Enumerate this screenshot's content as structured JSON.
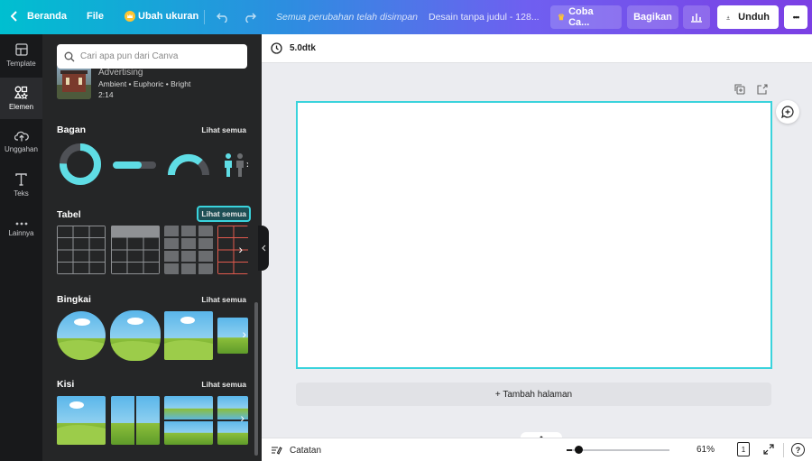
{
  "topbar": {
    "home_label": "Beranda",
    "file_label": "File",
    "resize_label": "Ubah ukuran",
    "save_status": "Semua perubahan telah disimpan",
    "doc_title": "Desain tanpa judul - 128...",
    "try_label": "Coba Ca...",
    "share_label": "Bagikan",
    "download_label": "Unduh",
    "more_label": "•••",
    "gradient": [
      "#00bfd0",
      "#6f5ff0",
      "#7b3fe4"
    ]
  },
  "rail": {
    "items": [
      {
        "label": "Template",
        "icon": "template-icon"
      },
      {
        "label": "Elemen",
        "icon": "elements-icon"
      },
      {
        "label": "Unggahan",
        "icon": "upload-cloud-icon"
      },
      {
        "label": "Teks",
        "icon": "text-icon"
      },
      {
        "label": "Lainnya",
        "icon": "more-dots-icon"
      }
    ]
  },
  "panel": {
    "search_placeholder": "Cari apa pun dari Canva",
    "audio": {
      "title": "Advertising",
      "meta": "Ambient • Euphoric • Bright",
      "duration": "2:14"
    },
    "sections": [
      {
        "title": "Bagan",
        "see_all": "Lihat semua"
      },
      {
        "title": "Tabel",
        "see_all": "Lihat semua"
      },
      {
        "title": "Bingkai",
        "see_all": "Lihat semua"
      },
      {
        "title": "Kisi",
        "see_all": "Lihat semua"
      }
    ]
  },
  "main": {
    "timer": "5.0dtk",
    "add_page": "+ Tambah halaman",
    "notes_label": "Catatan",
    "zoom": "61%",
    "zoom_fraction": 0.05,
    "page_count": "1",
    "help": "?"
  },
  "colors": {
    "accent_cyan": "#3ad3dc",
    "panel_bg": "#252627",
    "rail_bg": "#18191b"
  }
}
